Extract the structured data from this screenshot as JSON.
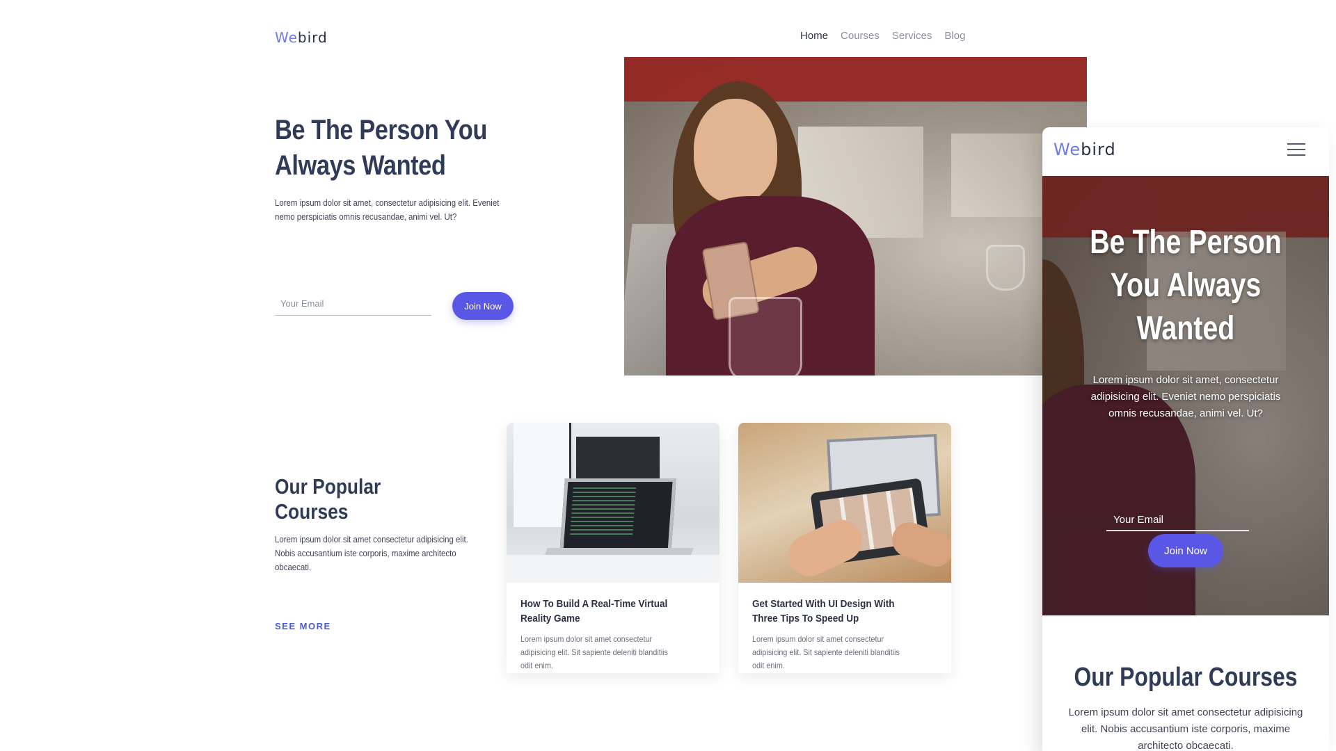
{
  "brand": {
    "logo_accent": "We",
    "logo_rest": "bird",
    "accent_color": "#5b57e6"
  },
  "nav": {
    "items": [
      "Home",
      "Courses",
      "Services",
      "Blog"
    ],
    "active": "Home"
  },
  "hero": {
    "title_line1": "Be The Person You",
    "title_line2": "Always Wanted",
    "text_line1": "Lorem ipsum dolor sit amet, consectetur adipisicing elit. Eveniet",
    "text_line2": "nemo perspiciatis omnis recusandae, animi vel. Ut?",
    "email_placeholder": "Your Email",
    "join_label": "Join Now"
  },
  "courses": {
    "title_line1": "Our Popular",
    "title_line2": "Courses",
    "text_line1": "Lorem ipsum dolor sit amet consectetur adipisicing elit.",
    "text_line2": "Nobis accusantium iste corporis, maxime architecto",
    "text_line3": "obcaecati.",
    "see_more": "SEE MORE",
    "cards": [
      {
        "title_line1": "How To Build A Real-Time Virtual",
        "title_line2": "Reality Game",
        "text_line1": "Lorem ipsum dolor sit amet consectetur",
        "text_line2": "adipisicing elit. Sit sapiente deleniti blanditiis",
        "text_line3": "odit enim."
      },
      {
        "title_line1": "Get Started With UI Design With",
        "title_line2": "Three Tips To Speed Up",
        "text_line1": "Lorem ipsum dolor sit amet consectetur",
        "text_line2": "adipisicing elit. Sit sapiente deleniti blanditiis",
        "text_line3": "odit enim."
      }
    ]
  },
  "mobile": {
    "title_line1": "Be The Person",
    "title_line2": "You Always",
    "title_line3": "Wanted",
    "text_line1": "Lorem ipsum dolor sit amet, consectetur",
    "text_line2": "adipisicing elit. Eveniet nemo perspiciatis",
    "text_line3": "omnis recusandae, animi vel. Ut?",
    "email_placeholder": "Your Email",
    "join_label": "Join Now",
    "courses_title": "Our Popular Courses",
    "courses_text_line1": "Lorem ipsum dolor sit amet consectetur adipisicing",
    "courses_text_line2": "elit. Nobis accusantium iste corporis, maxime",
    "courses_text_line3": "architecto obcaecati."
  }
}
